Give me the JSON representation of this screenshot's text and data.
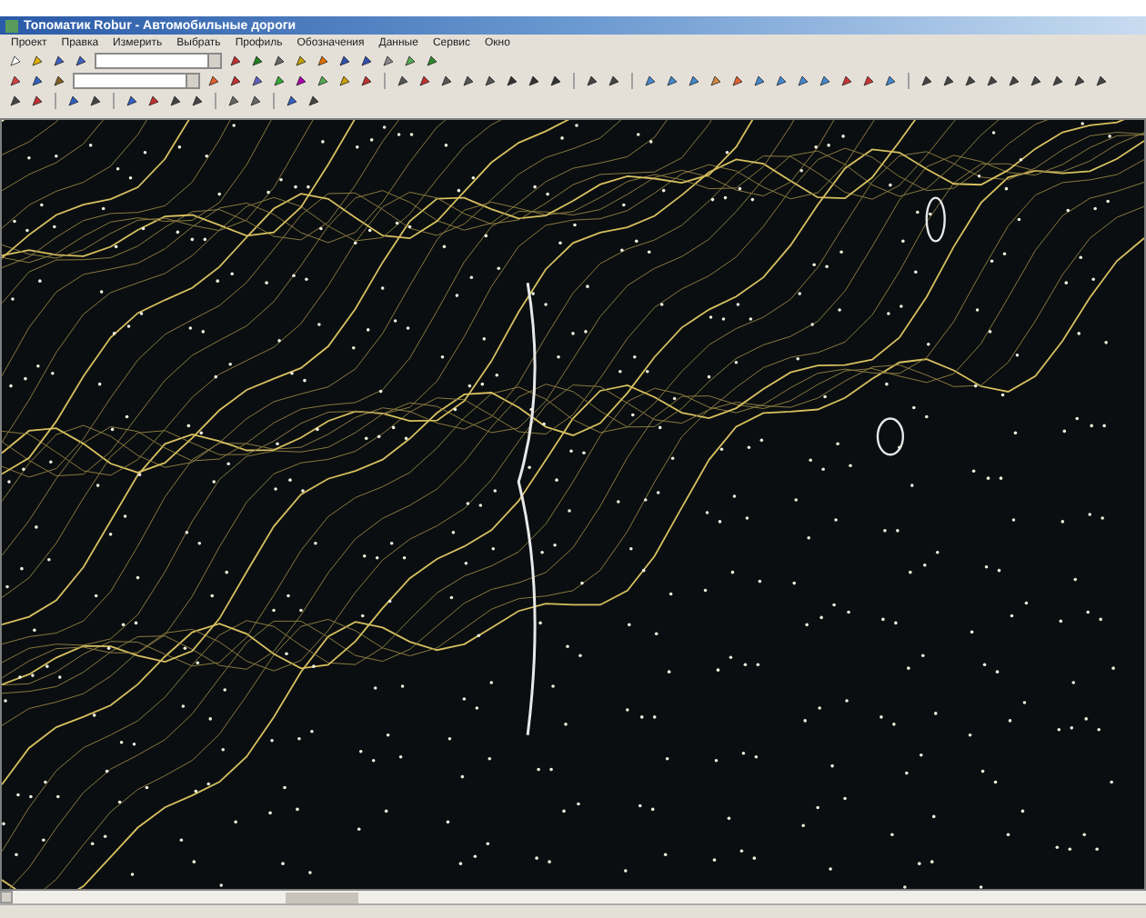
{
  "window": {
    "title": "Топоматик Robur - Автомобильные дороги"
  },
  "menu": [
    {
      "label": "Проект"
    },
    {
      "label": "Правка"
    },
    {
      "label": "Измерить"
    },
    {
      "label": "Выбрать"
    },
    {
      "label": "Профиль"
    },
    {
      "label": "Обозначения"
    },
    {
      "label": "Данные"
    },
    {
      "label": "Сервис"
    },
    {
      "label": "Окно"
    }
  ]
}
